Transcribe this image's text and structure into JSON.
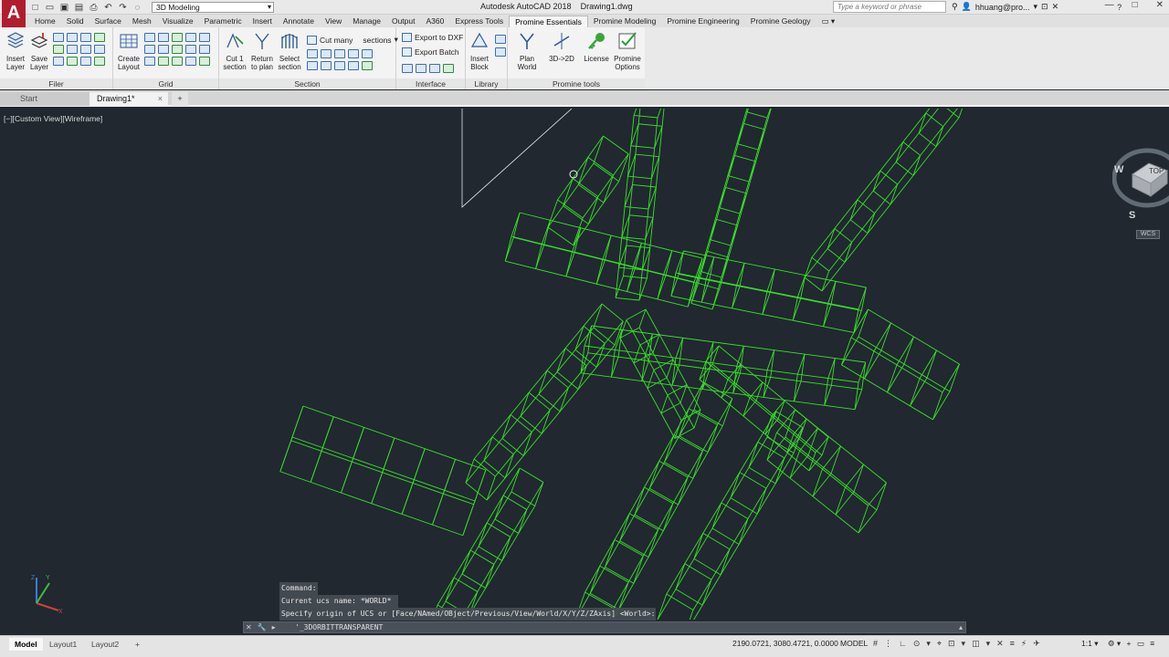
{
  "titlebar": {
    "logo": "A",
    "workspace": "3D Modeling",
    "window_title": "Autodesk AutoCAD 2018    Drawing1.dwg",
    "search_placeholder": "Type a keyword or phrase",
    "account": "hhuang@pro..."
  },
  "ribbon_tabs": [
    "Home",
    "Solid",
    "Surface",
    "Mesh",
    "Visualize",
    "Parametric",
    "Insert",
    "Annotate",
    "View",
    "Manage",
    "Output",
    "A360",
    "Express Tools",
    "Promine Essentials",
    "Promine Modeling",
    "Promine Engineering",
    "Promine Geology"
  ],
  "ribbon_active_tab": "Promine Essentials",
  "panels": {
    "filer": {
      "title": "Filer",
      "insert_layer": "Insert\nLayer",
      "save_layer": "Save\nLayer"
    },
    "grid": {
      "title": "Grid",
      "create_layout": "Create\nLayout"
    },
    "section": {
      "title": "Section",
      "cut1": "Cut 1\nsection",
      "return": "Return\nto plan",
      "select": "Select\nsection",
      "cut_many": "Cut many",
      "sections": "sections"
    },
    "interface": {
      "title": "Interface",
      "export_dxf": "Export to DXF",
      "export_batch": "Export Batch"
    },
    "library": {
      "title": "Library",
      "insert_block": "Insert\nBlock"
    },
    "promine_tools": {
      "title": "Promine tools",
      "plan_world": "Plan\nWorld",
      "three_d_two_d": "3D->2D",
      "license": "License",
      "options": "Promine\nOptions"
    }
  },
  "file_tabs": {
    "start": "Start",
    "drawing": "Drawing1*",
    "close": "×",
    "new": "+"
  },
  "viewport": {
    "label": "[−][Custom View][Wireframe]",
    "viewcube_top": "TOP",
    "viewcube_w": "W",
    "viewcube_s": "S",
    "wcs": "WCS",
    "ucs_y": "Y",
    "ucs_z": "Z",
    "ucs_x": "X"
  },
  "command": {
    "history": [
      "Command:",
      "Current ucs name:  *WORLD*",
      "Specify origin of UCS or [Face/NAmed/OBject/Previous/View/World/X/Y/Z/ZAxis] <World>:"
    ],
    "input": "'_3DORBITTRANSPARENT"
  },
  "statusbar": {
    "tabs": [
      "Model",
      "Layout1",
      "Layout2"
    ],
    "add": "+",
    "coords": "2190.0721, 3080.4721, 0.0000",
    "space": "MODEL",
    "scale": "1:1"
  },
  "colors": {
    "wire": "#39e02a",
    "background": "#212830",
    "accent": "#b01e2e"
  }
}
